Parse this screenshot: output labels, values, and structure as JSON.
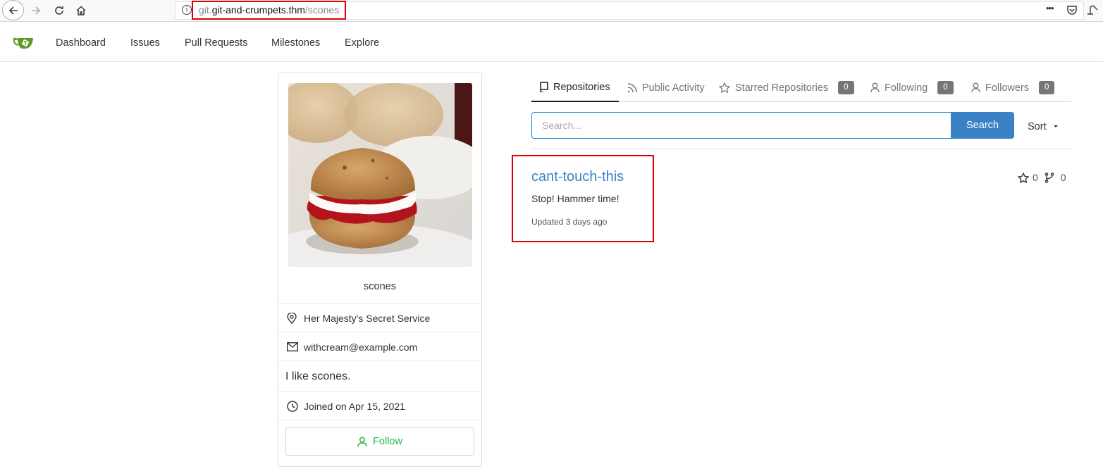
{
  "browser": {
    "url_subdomain": "git.",
    "url_host": "git-and-crumpets.thm",
    "url_path": "/scones",
    "info_glyph": "i",
    "menu_glyph": "•••"
  },
  "header": {
    "nav": [
      "Dashboard",
      "Issues",
      "Pull Requests",
      "Milestones",
      "Explore"
    ]
  },
  "profile": {
    "username": "scones",
    "location": "Her Majesty's Secret Service",
    "email": "withcream@example.com",
    "bio": "I like scones.",
    "joined": "Joined on Apr 15, 2021",
    "follow_label": "Follow"
  },
  "tabs": {
    "repositories": "Repositories",
    "public_activity": "Public Activity",
    "starred": "Starred Repositories",
    "starred_count": "0",
    "following": "Following",
    "following_count": "0",
    "followers": "Followers",
    "followers_count": "0"
  },
  "search": {
    "placeholder": "Search...",
    "button_label": "Search",
    "sort_label": "Sort"
  },
  "repos": [
    {
      "name": "cant-touch-this",
      "description": "Stop! Hammer time!",
      "updated": "Updated 3 days ago",
      "stars": "0",
      "forks": "0"
    }
  ],
  "colors": {
    "accent": "#3a82c5",
    "follow_green": "#21ba45",
    "highlight_red": "#e00000",
    "logo_green": "#609926"
  }
}
